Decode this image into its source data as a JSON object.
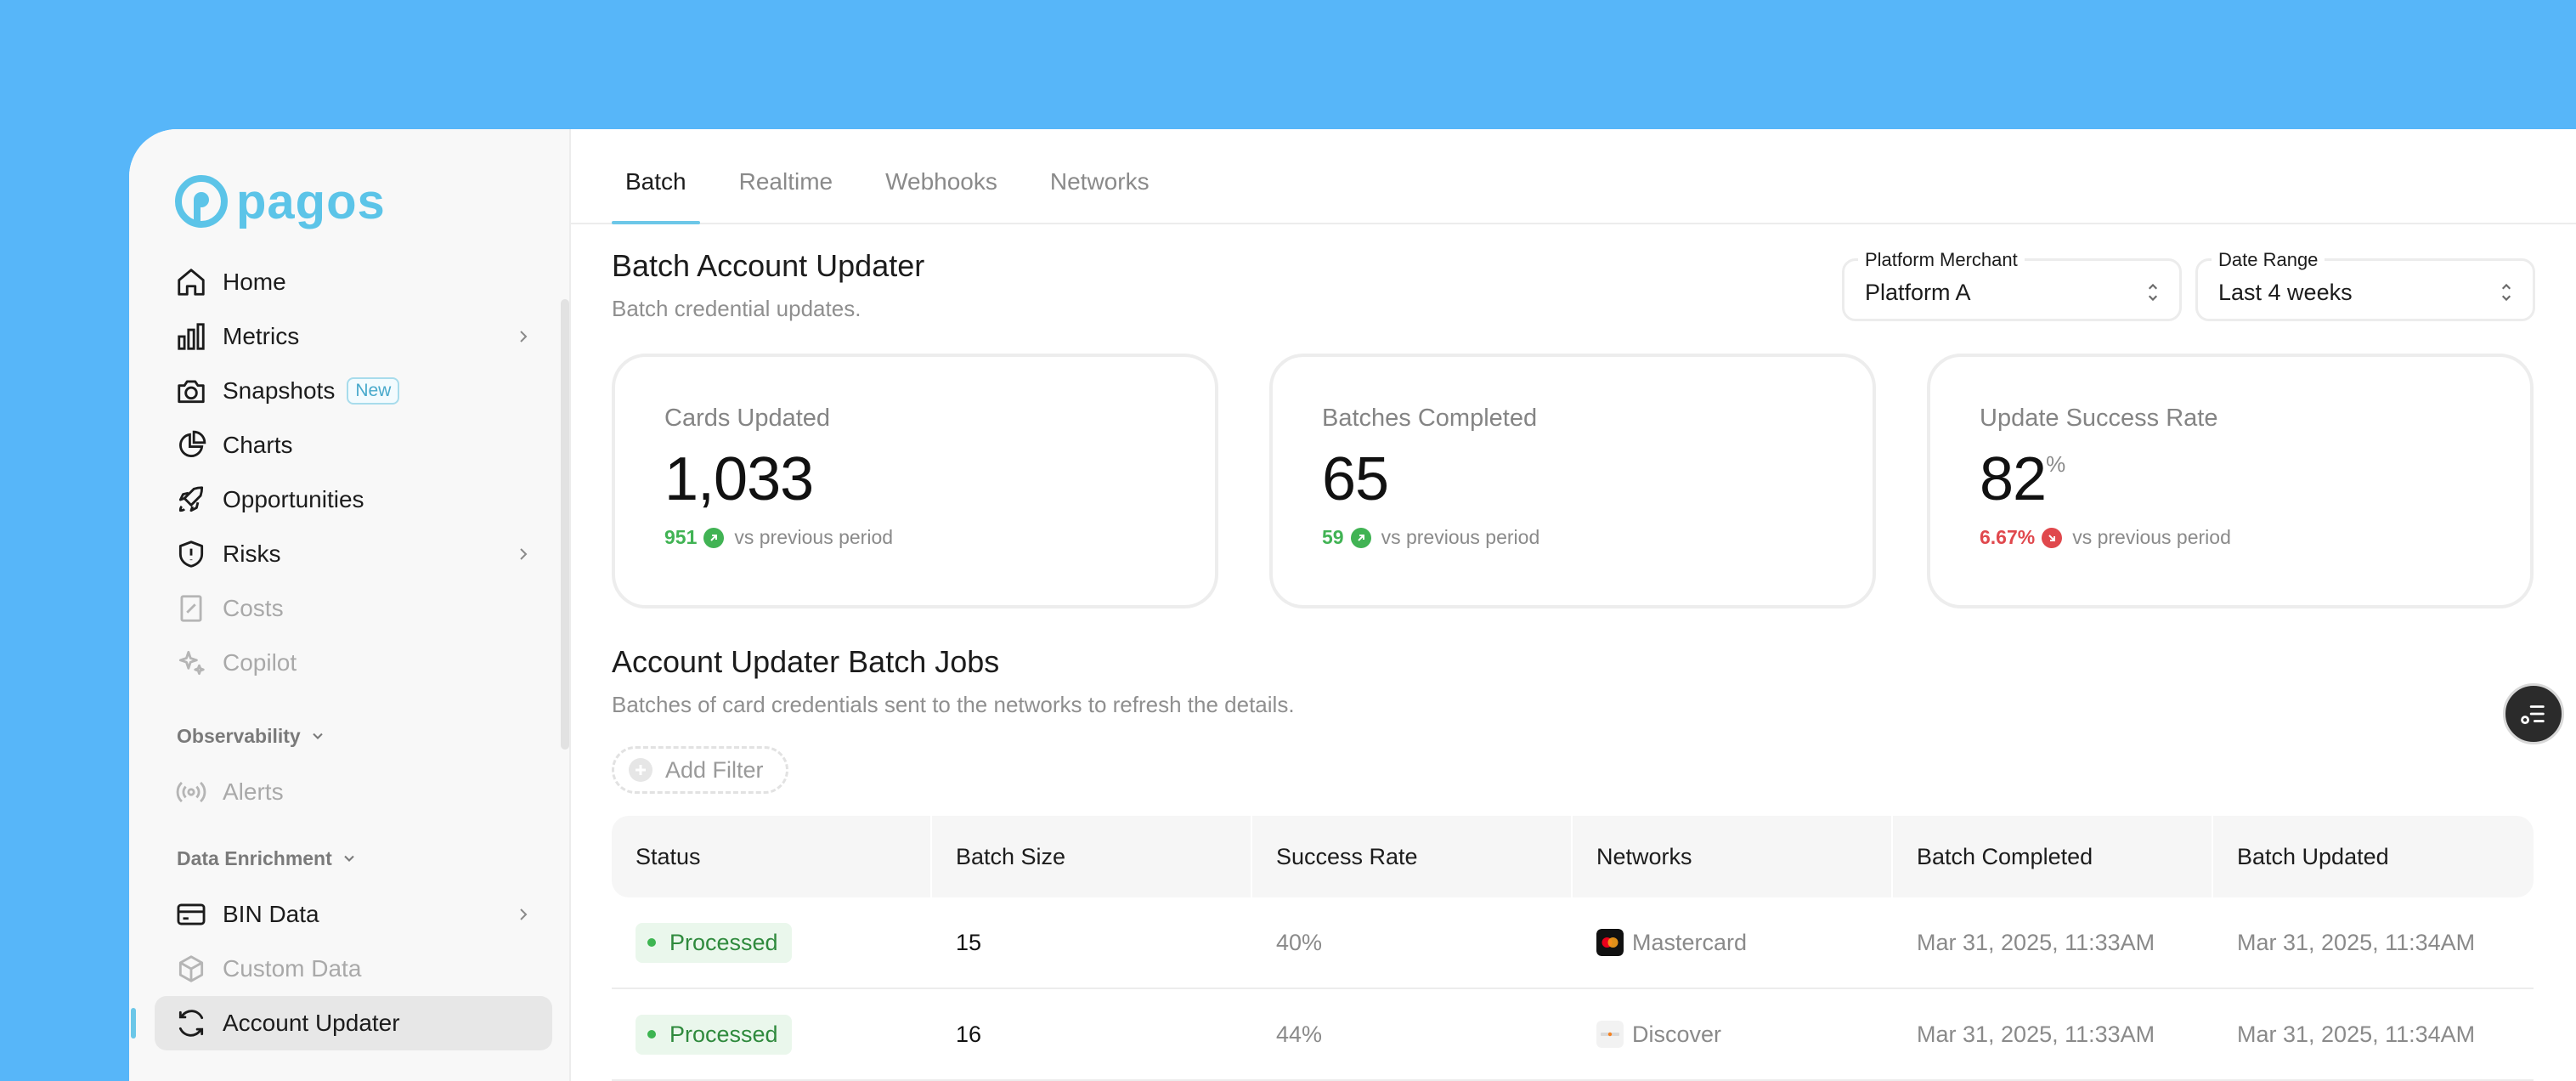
{
  "brand": {
    "name": "pagos",
    "color": "#5cc4e8"
  },
  "sidebar": {
    "items": [
      {
        "label": "Home",
        "icon": "home-icon",
        "disabled": false
      },
      {
        "label": "Metrics",
        "icon": "bar-chart-icon",
        "disabled": false,
        "chevron": true
      },
      {
        "label": "Snapshots",
        "icon": "camera-icon",
        "disabled": false,
        "badge": "New"
      },
      {
        "label": "Charts",
        "icon": "pie-chart-icon",
        "disabled": false
      },
      {
        "label": "Opportunities",
        "icon": "rocket-icon",
        "disabled": false
      },
      {
        "label": "Risks",
        "icon": "shield-icon",
        "disabled": false,
        "chevron": true
      },
      {
        "label": "Costs",
        "icon": "receipt-icon",
        "disabled": true
      },
      {
        "label": "Copilot",
        "icon": "sparkles-icon",
        "disabled": true
      }
    ],
    "observability": {
      "label": "Observability",
      "items": [
        {
          "label": "Alerts",
          "icon": "broadcast-icon",
          "disabled": true
        }
      ]
    },
    "data_enrichment": {
      "label": "Data Enrichment",
      "items": [
        {
          "label": "BIN Data",
          "icon": "credit-card-icon",
          "disabled": false,
          "chevron": true
        },
        {
          "label": "Custom Data",
          "icon": "cube-icon",
          "disabled": true
        },
        {
          "label": "Account Updater",
          "icon": "refresh-icon",
          "disabled": false,
          "active": true
        }
      ]
    }
  },
  "tabs": [
    {
      "label": "Batch",
      "active": true
    },
    {
      "label": "Realtime",
      "active": false
    },
    {
      "label": "Webhooks",
      "active": false
    },
    {
      "label": "Networks",
      "active": false
    }
  ],
  "header": {
    "title": "Batch Account Updater",
    "subtitle": "Batch credential updates."
  },
  "filters": {
    "merchant": {
      "label": "Platform Merchant",
      "value": "Platform A"
    },
    "date_range": {
      "label": "Date Range",
      "value": "Last 4 weeks"
    }
  },
  "cards": [
    {
      "title": "Cards Updated",
      "value": "1,033",
      "unit": "",
      "delta": "951",
      "direction": "up",
      "delta_text": "vs previous period"
    },
    {
      "title": "Batches Completed",
      "value": "65",
      "unit": "",
      "delta": "59",
      "direction": "up",
      "delta_text": "vs previous period"
    },
    {
      "title": "Update Success Rate",
      "value": "82",
      "unit": "%",
      "delta": "6.67%",
      "direction": "down",
      "delta_text": "vs previous period"
    }
  ],
  "jobs": {
    "title": "Account Updater Batch Jobs",
    "subtitle": "Batches of card credentials sent to the networks to refresh the details.",
    "add_filter": "Add Filter",
    "columns": [
      "Status",
      "Batch Size",
      "Success Rate",
      "Networks",
      "Batch Completed",
      "Batch Updated"
    ],
    "rows": [
      {
        "status": "Processed",
        "batch_size": "15",
        "success_rate": "40%",
        "network": "Mastercard",
        "network_icon": "mastercard-icon",
        "completed": "Mar 31, 2025, 11:33AM",
        "updated": "Mar 31, 2025, 11:34AM"
      },
      {
        "status": "Processed",
        "batch_size": "16",
        "success_rate": "44%",
        "network": "Discover",
        "network_icon": "discover-icon",
        "completed": "Mar 31, 2025, 11:33AM",
        "updated": "Mar 31, 2025, 11:34AM"
      }
    ]
  },
  "colors": {
    "background": "#57b6f9",
    "accent": "#6cc7e8",
    "positive": "#41b354",
    "negative": "#e0484d"
  }
}
